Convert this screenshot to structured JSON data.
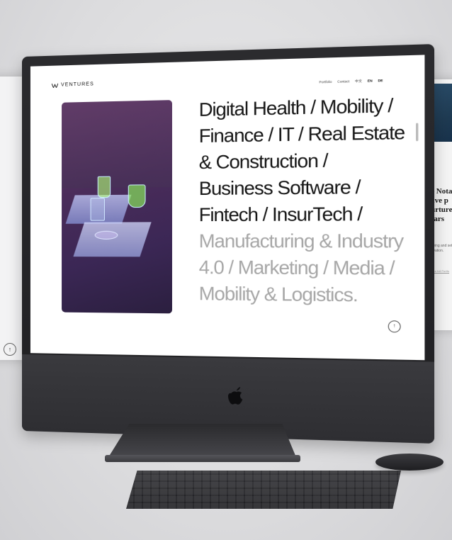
{
  "site": {
    "logo_text": "VENTURES",
    "nav": [
      "Portfolio",
      "Contact",
      "中文",
      "EN",
      "DE"
    ],
    "headline_dark": "Digital Health / Mobility / Finance / IT / Real Estate & Construction / Business Software / Fintech / InsurTech /",
    "headline_light": "Manufacturing & Industry 4.0 / Marketing / Media / Mobility & Logistics.",
    "up_button": "↑"
  },
  "side_panel_right": {
    "heading_lines": [
      "— Nota",
      "have p",
      "nurture",
      "years"
    ],
    "body": "Growing and setting new innovation.",
    "link": "See our full Portfo"
  },
  "side_panel_left": {
    "up_button": "↑"
  },
  "colors": {
    "text_dark": "#161616",
    "text_light": "#a7a7a7",
    "screen_bg": "#ffffff"
  }
}
